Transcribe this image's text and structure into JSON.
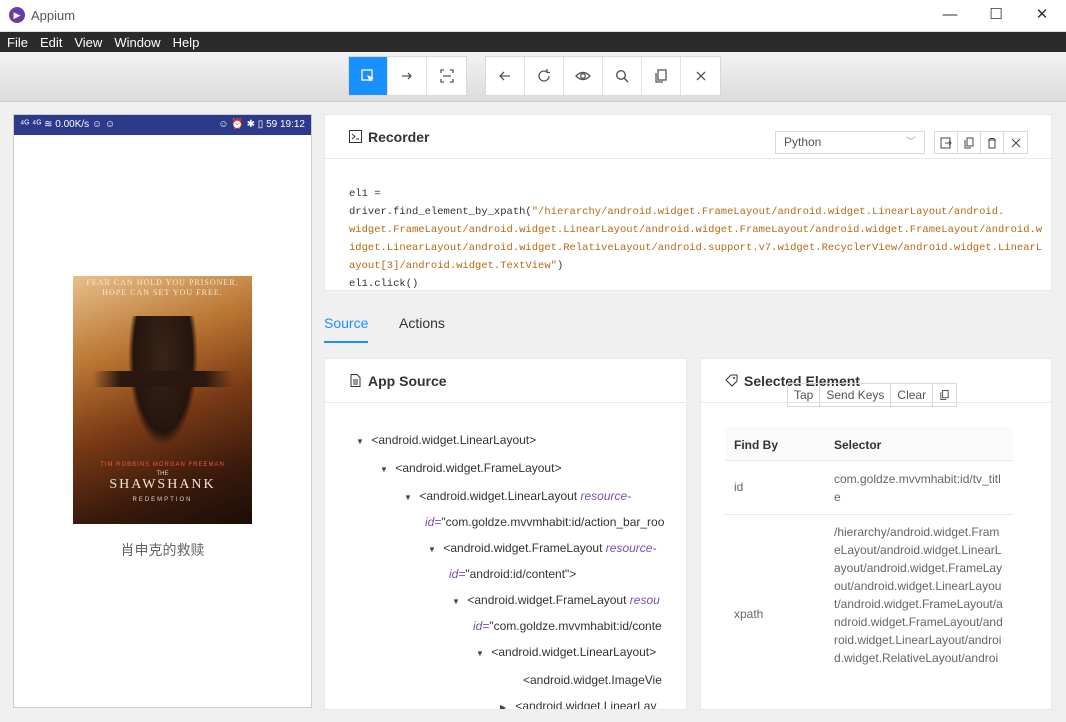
{
  "window": {
    "title": "Appium",
    "minimize": "—",
    "maximize": "☐",
    "close": "✕"
  },
  "menu": [
    "File",
    "Edit",
    "View",
    "Window",
    "Help"
  ],
  "device": {
    "status_left": "⁴ᴳ ⁴ᴳ ≋ 0.00K/s ☺ ☺",
    "status_right": "☺ ⏰ ✱ ▯ 59 19:12",
    "poster_tagline": "FEAR CAN HOLD YOU PRISONER. HOPE CAN SET YOU FREE.",
    "poster_names": "TIM ROBBINS    MORGAN FREEMAN",
    "poster_the": "THE",
    "poster_title": "SHAWSHANK",
    "poster_subtitle": "REDEMPTION",
    "caption": "肖申克的救赎"
  },
  "recorder": {
    "title": "Recorder",
    "language": "Python",
    "code": {
      "line1_prefix": "el1 = driver.find_element_by_xpath(",
      "line1_str": "\"/hierarchy/android.widget.FrameLayout/android.widget.LinearLayout/android.",
      "line2": "widget.FrameLayout/android.widget.LinearLayout/android.widget.FrameLayout/android.widget.FrameLayout/android.w",
      "line3": "idget.LinearLayout/android.widget.RelativeLayout/android.support.v7.widget.RecyclerView/android.widget.LinearL",
      "line4_str": "ayout[3]/android.widget.TextView\"",
      "line4_suffix": ")",
      "line5": "el1.click()"
    }
  },
  "tabs": [
    {
      "label": "Source"
    },
    {
      "label": "Actions"
    }
  ],
  "app_source": {
    "title": "App Source",
    "nodes": [
      {
        "tag": "<android.widget.LinearLayout>",
        "attr": "",
        "val": ""
      },
      {
        "tag": "<android.widget.FrameLayout>",
        "attr": "",
        "val": ""
      },
      {
        "tag": "<android.widget.LinearLayout ",
        "attr": "resource-",
        "cont": "id=",
        "val": "\"com.goldze.mvvmhabit:id/action_bar_roo"
      },
      {
        "tag": "<android.widget.FrameLayout ",
        "attr": "resource-",
        "cont": "id=",
        "val": "\"android:id/content\">"
      },
      {
        "tag": "<android.widget.FrameLayout ",
        "attr": "resou",
        "cont": "id=",
        "val": "\"com.goldze.mvvmhabit:id/conte"
      },
      {
        "tag": "<android.widget.LinearLayout>",
        "attr": "",
        "val": ""
      },
      {
        "tag": "<android.widget.ImageVie",
        "attr": "",
        "val": ""
      },
      {
        "tag": "<android.widget.LinearLay",
        "attr": "",
        "val": ""
      }
    ]
  },
  "selected_element": {
    "title": "Selected Element",
    "actions": [
      "Tap",
      "Send Keys",
      "Clear"
    ],
    "table_headers": [
      "Find By",
      "Selector"
    ],
    "rows": [
      {
        "by": "id",
        "selector": "com.goldze.mvvmhabit:id/tv_title"
      },
      {
        "by": "xpath",
        "selector": "/hierarchy/android.widget.FrameLayout/android.widget.LinearLayout/android.widget.FrameLayout/android.widget.LinearLayout/android.widget.FrameLayout/android.widget.FrameLayout/android.widget.LinearLayout/android.widget.RelativeLayout/androi"
      }
    ]
  }
}
